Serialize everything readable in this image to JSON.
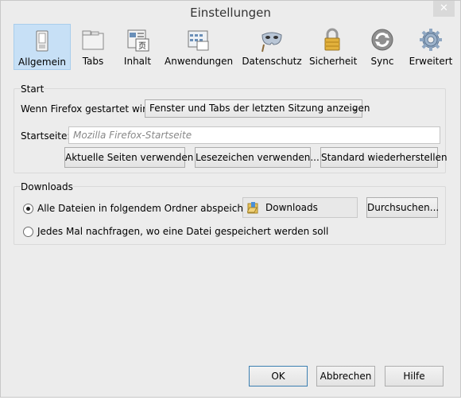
{
  "window": {
    "title": "Einstellungen",
    "close": "✕"
  },
  "toolbar": {
    "items": [
      {
        "label": "Allgemein",
        "icon": "switch-icon"
      },
      {
        "label": "Tabs",
        "icon": "tabs-icon"
      },
      {
        "label": "Inhalt",
        "icon": "content-icon"
      },
      {
        "label": "Anwendungen",
        "icon": "applications-icon"
      },
      {
        "label": "Datenschutz",
        "icon": "mask-icon"
      },
      {
        "label": "Sicherheit",
        "icon": "lock-icon"
      },
      {
        "label": "Sync",
        "icon": "sync-icon"
      },
      {
        "label": "Erweitert",
        "icon": "gear-icon"
      }
    ],
    "selected": "Allgemein"
  },
  "start": {
    "group_label": "Start",
    "when_label": "Wenn Firefox gestartet wird:",
    "when_value": "Fenster und Tabs der letzten Sitzung anzeigen",
    "homepage_label": "Startseite:",
    "homepage_placeholder": "Mozilla Firefox-Startseite",
    "btn_current": "Aktuelle Seiten verwenden",
    "btn_bookmark": "Lesezeichen verwenden...",
    "btn_default": "Standard wiederherstellen"
  },
  "downloads": {
    "group_label": "Downloads",
    "option_save": "Alle Dateien in folgendem Ordner abspeichern:",
    "folder_name": "Downloads",
    "btn_browse": "Durchsuchen...",
    "option_ask": "Jedes Mal nachfragen, wo eine Datei gespeichert werden soll",
    "selected_option": "save"
  },
  "footer": {
    "ok": "OK",
    "cancel": "Abbrechen",
    "help": "Hilfe"
  },
  "colors": {
    "selected_tab_bg": "#c7e0f6",
    "window_bg": "#ececec",
    "default_button_border": "#3c7fb1"
  }
}
